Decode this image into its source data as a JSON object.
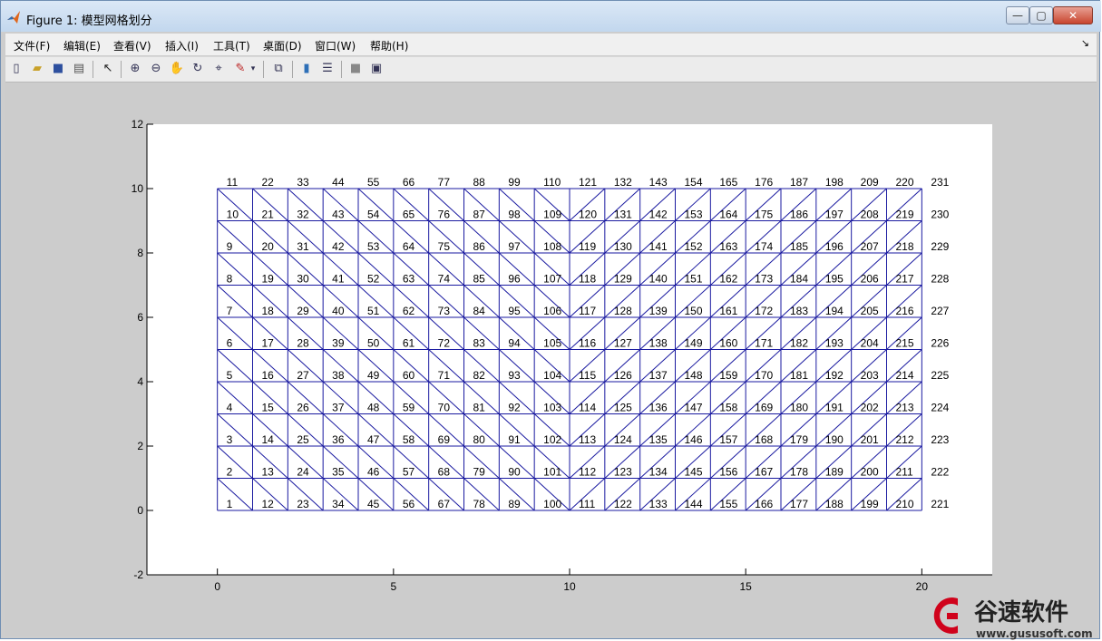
{
  "window": {
    "title": "Figure 1: 模型网格划分",
    "controls": {
      "minimize": "—",
      "maximize": "▢",
      "close": "✕"
    }
  },
  "menu": {
    "items": [
      "文件(F)",
      "编辑(E)",
      "查看(V)",
      "插入(I)",
      "工具(T)",
      "桌面(D)",
      "窗口(W)",
      "帮助(H)"
    ],
    "dock": "↘"
  },
  "toolbar": {
    "icons": [
      "new-figure-icon",
      "open-file-icon",
      "save-icon",
      "print-icon",
      "edit-plot-arrow-icon",
      "zoom-in-icon",
      "zoom-out-icon",
      "pan-hand-icon",
      "rotate-3d-icon",
      "data-cursor-icon",
      "brush-icon",
      "brush-dropdown-icon",
      "link-plot-icon",
      "insert-colorbar-icon",
      "insert-legend-icon",
      "hide-plot-tools-icon",
      "show-plot-tools-icon"
    ]
  },
  "chart_data": {
    "type": "scatter",
    "description_kind": "triangular finite-element mesh with node numbers",
    "xlim": [
      -2,
      22
    ],
    "ylim": [
      -2,
      12
    ],
    "x_ticks": [
      0,
      5,
      10,
      15,
      20
    ],
    "y_ticks": [
      -2,
      0,
      2,
      4,
      6,
      8,
      10,
      12
    ],
    "nodes": {
      "x_values": [
        0,
        1,
        2,
        3,
        4,
        5,
        6,
        7,
        8,
        9,
        10,
        11,
        12,
        13,
        14,
        15,
        16,
        17,
        18,
        19,
        20
      ],
      "y_values": [
        0,
        1,
        2,
        3,
        4,
        5,
        6,
        7,
        8,
        9,
        10
      ],
      "numbering": "node = column_index * 11 + row_index + 1",
      "labels": [
        [
          1,
          2,
          3,
          4,
          5,
          6,
          7,
          8,
          9,
          10,
          11
        ],
        [
          12,
          13,
          14,
          15,
          16,
          17,
          18,
          19,
          20,
          21,
          22
        ],
        [
          23,
          24,
          25,
          26,
          27,
          28,
          29,
          30,
          31,
          32,
          33
        ],
        [
          34,
          35,
          36,
          37,
          38,
          39,
          40,
          41,
          42,
          43,
          44
        ],
        [
          45,
          46,
          47,
          48,
          49,
          50,
          51,
          52,
          53,
          54,
          55
        ],
        [
          56,
          57,
          58,
          59,
          60,
          61,
          62,
          63,
          64,
          65,
          66
        ],
        [
          67,
          68,
          69,
          70,
          71,
          72,
          73,
          74,
          75,
          76,
          77
        ],
        [
          78,
          79,
          80,
          81,
          82,
          83,
          84,
          85,
          86,
          87,
          88
        ],
        [
          89,
          90,
          91,
          92,
          93,
          94,
          95,
          96,
          97,
          98,
          99
        ],
        [
          100,
          101,
          102,
          103,
          104,
          105,
          106,
          107,
          108,
          109,
          110
        ],
        [
          111,
          112,
          113,
          114,
          115,
          116,
          117,
          118,
          119,
          120,
          121
        ],
        [
          122,
          123,
          124,
          125,
          126,
          127,
          128,
          129,
          130,
          131,
          132
        ],
        [
          133,
          134,
          135,
          136,
          137,
          138,
          139,
          140,
          141,
          142,
          143
        ],
        [
          144,
          145,
          146,
          147,
          148,
          149,
          150,
          151,
          152,
          153,
          154
        ],
        [
          155,
          156,
          157,
          158,
          159,
          160,
          161,
          162,
          163,
          164,
          165
        ],
        [
          166,
          167,
          168,
          169,
          170,
          171,
          172,
          173,
          174,
          175,
          176
        ],
        [
          177,
          178,
          179,
          180,
          181,
          182,
          183,
          184,
          185,
          186,
          187
        ],
        [
          188,
          189,
          190,
          191,
          192,
          193,
          194,
          195,
          196,
          197,
          198
        ],
        [
          199,
          200,
          201,
          202,
          203,
          204,
          205,
          206,
          207,
          208,
          209
        ],
        [
          210,
          211,
          212,
          213,
          214,
          215,
          216,
          217,
          218,
          219,
          220
        ],
        [
          221,
          222,
          223,
          224,
          225,
          226,
          227,
          228,
          229,
          230,
          231
        ]
      ]
    },
    "diagonals": {
      "left_half_x_range": [
        0,
        10
      ],
      "left_half": "top-left to bottom-right",
      "right_half_x_range": [
        10,
        20
      ],
      "right_half": "bottom-left to top-right"
    },
    "mesh_color": "#1a1aa0",
    "grid": false,
    "legend": "none"
  },
  "watermark": {
    "brand": "谷速软件",
    "url": "www.gususoft.com",
    "color": "#d0021b"
  }
}
